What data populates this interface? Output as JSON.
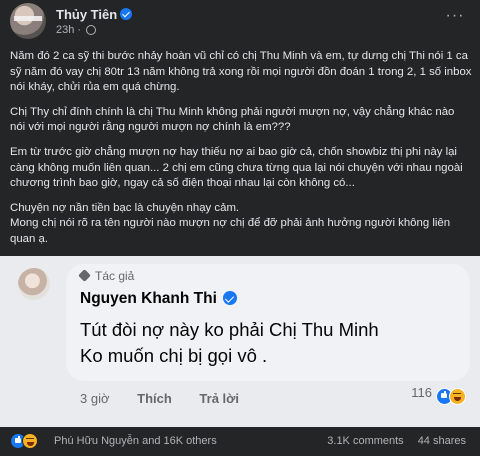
{
  "post": {
    "author": "Thủy Tiên",
    "time": "23h",
    "more_label": "···",
    "paragraphs": [
      "Năm đó 2 ca sỹ thi bước nhảy hoàn vũ chỉ có chị Thu Minh và em, tự dưng chị Thi nói 1 ca sỹ năm đó vay chị 80tr 13 năm không trả xong rồi mọi người đồn đoán 1 trong 2, 1 số inbox nói kháy, chửi rủa em quá chừng.",
      "Chị Thy chỉ đính chính là chị Thu Minh không phải người mượn nợ, vậy chẳng khác nào nói với mọi người rằng người mượn nợ chính là em???",
      "Em từ trước giờ chẳng mượn nợ hay thiếu nợ ai bao giờ cả, chốn showbiz thị phi này lại càng không muốn liên quan... 2 chị em cũng chưa từng qua lại nói chuyện với nhau ngoài chương trình bao giờ, ngay cả số điện thoại nhau lại còn không có...",
      "Chuyện nợ nần tiền bạc là chuyện nhạy cảm.\nMong chị nói rõ ra tên người nào mượn nợ chị để đỡ phải ảnh hưởng người không liên quan ạ."
    ]
  },
  "comment": {
    "tag": "Tác giả",
    "name": "Nguyen Khanh Thi",
    "line1": "Tút đòi nợ này ko phải Chị Thu Minh",
    "line2": "Ko muốn chị bị gọi vô .",
    "time": "3 giờ",
    "like_label": "Thích",
    "reply_label": "Trả lời",
    "reaction_count": "116"
  },
  "footer": {
    "reactors": "Phú Hữu Nguyễn and 16K others",
    "comments": "3.1K comments",
    "shares": "44 shares"
  },
  "colors": {
    "background": "#242526",
    "verified": "#1877f2",
    "comment_bg": "#f0f2f5"
  }
}
